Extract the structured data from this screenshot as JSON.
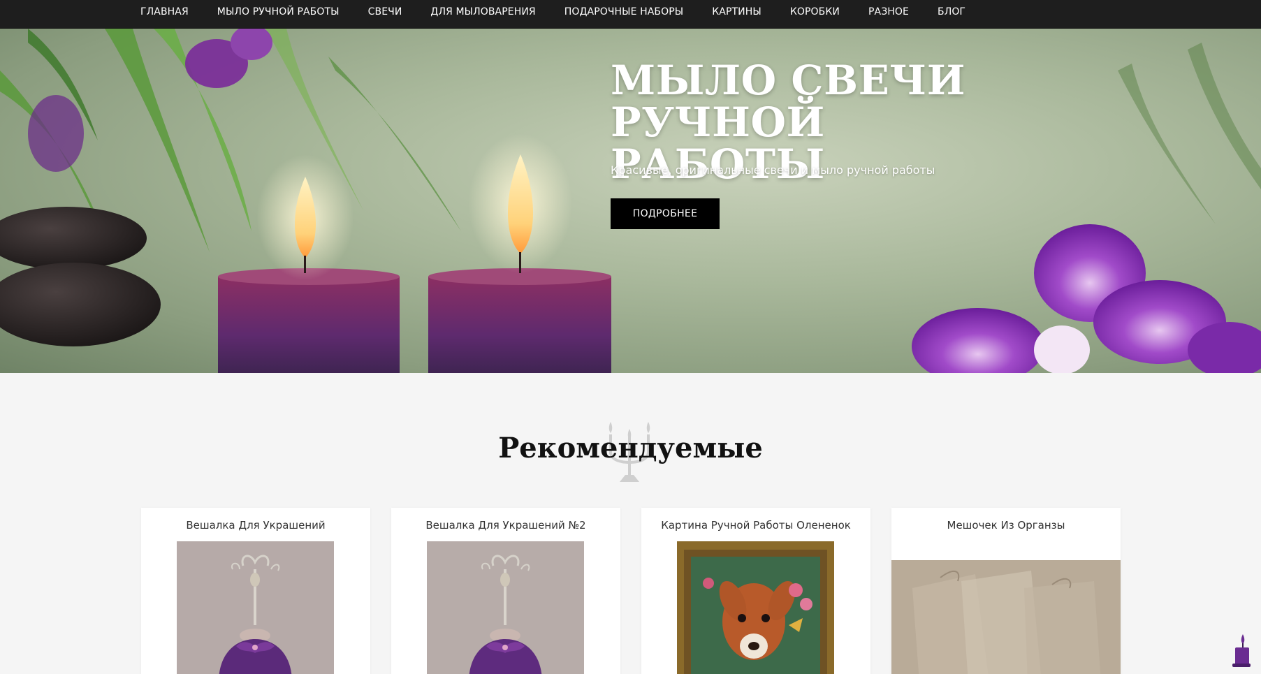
{
  "nav": {
    "items": [
      "ГЛАВНАЯ",
      "МЫЛО РУЧНОЙ РАБОТЫ",
      "СВЕЧИ",
      "ДЛЯ МЫЛОВАРЕНИЯ",
      "ПОДАРОЧНЫЕ НАБОРЫ",
      "КАРТИНЫ",
      "КОРОБКИ",
      "РАЗНОЕ",
      "БЛОГ"
    ]
  },
  "hero": {
    "title_line1": "МЫЛО СВЕЧИ РУЧНОЙ",
    "title_line2": "РАБОТЫ",
    "subtitle": "Красивые, оригинальные свечи и мыло ручной работы",
    "button_label": "ПОДРОБНЕЕ"
  },
  "featured": {
    "title": "Рекомендуемые",
    "products": [
      {
        "title": "Вешалка Для Украшений"
      },
      {
        "title": "Вешалка Для Украшений №2"
      },
      {
        "title": "Картина Ручной Работы Олененок"
      },
      {
        "title": "Мешочек Из Органзы"
      }
    ]
  },
  "colors": {
    "nav_bg": "#1e1e1e",
    "accent": "#6a2c91",
    "button_bg": "#000000"
  },
  "icons": {
    "chat": "candle-icon",
    "emblem": "candelabra-icon"
  }
}
